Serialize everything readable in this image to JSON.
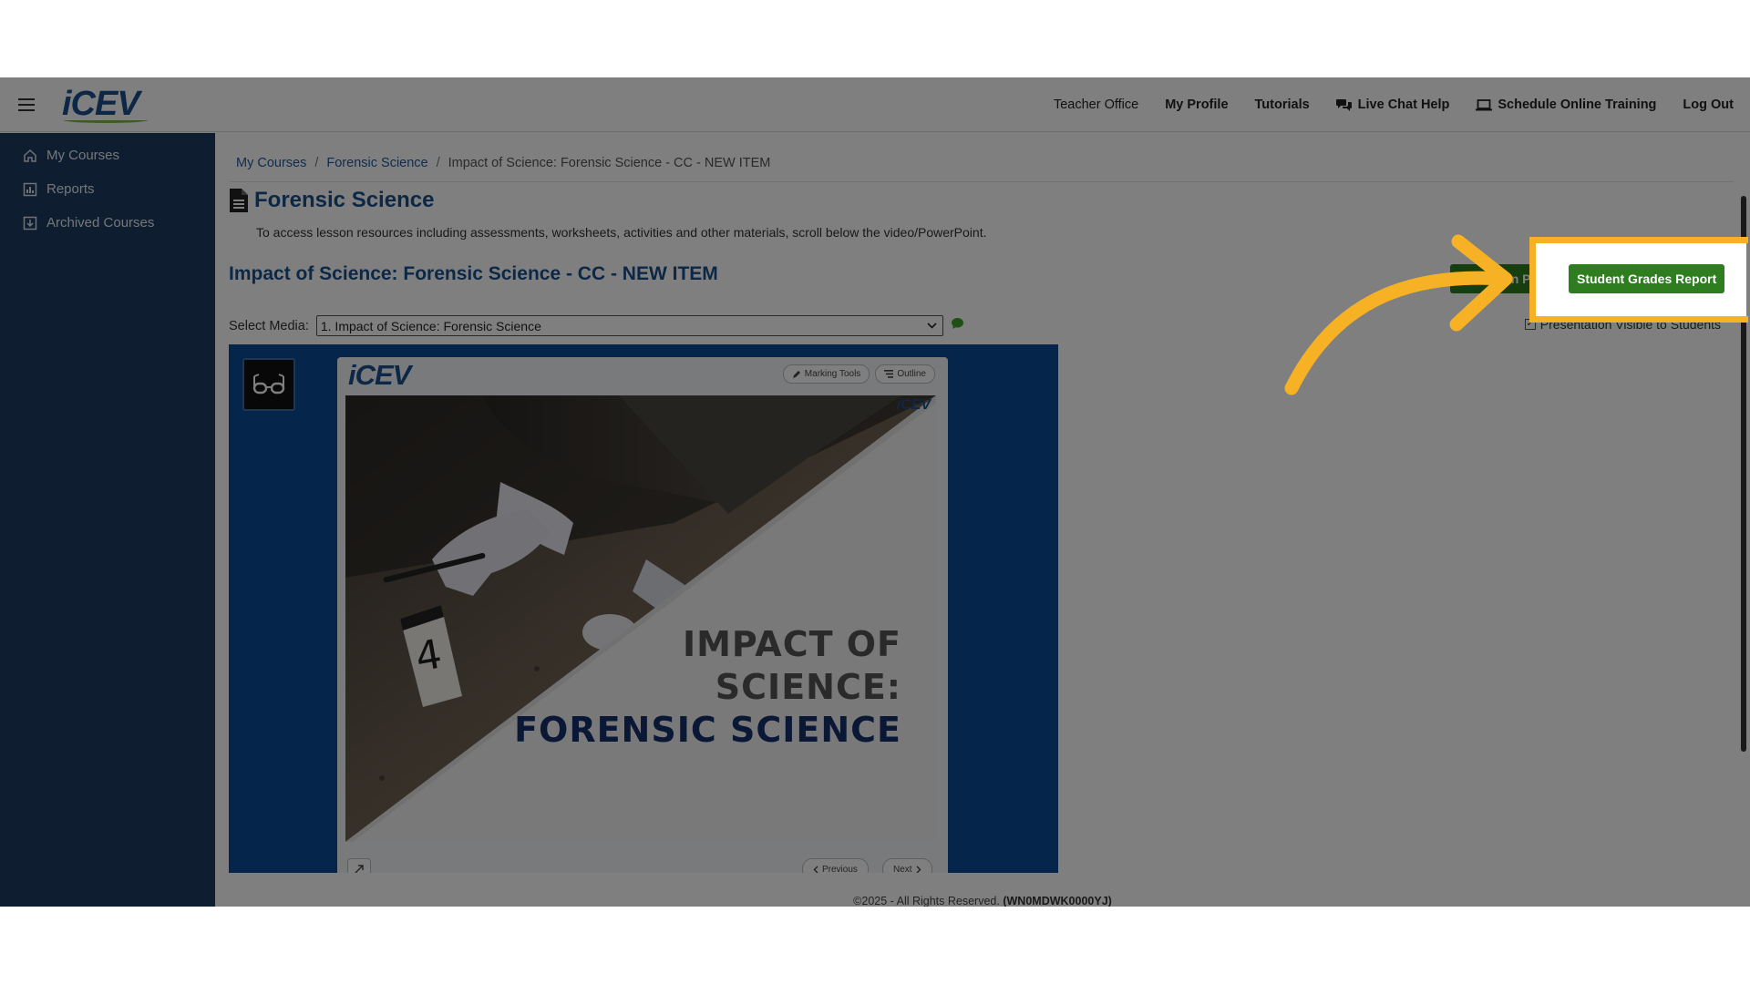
{
  "header": {
    "logo_text": "iCEV",
    "nav": [
      {
        "label": "Teacher Office",
        "icon": ""
      },
      {
        "label": "My Profile",
        "icon": ""
      },
      {
        "label": "Tutorials",
        "icon": ""
      },
      {
        "label": "Live Chat Help",
        "icon": "chat-bubbles-icon"
      },
      {
        "label": "Schedule Online Training",
        "icon": "laptop-icon"
      },
      {
        "label": "Log Out",
        "icon": ""
      }
    ]
  },
  "sidebar": {
    "items": [
      {
        "label": "My Courses",
        "icon": "home-icon"
      },
      {
        "label": "Reports",
        "icon": "report-icon"
      },
      {
        "label": "Archived Courses",
        "icon": "archive-icon"
      }
    ]
  },
  "breadcrumb": {
    "items": [
      "My Courses",
      "Forensic Science",
      "Impact of Science: Forensic Science - CC - NEW ITEM"
    ]
  },
  "page": {
    "title": "Forensic Science",
    "description": "To access lesson resources including assessments, worksheets, activities and other materials, scroll below the video/PowerPoint.",
    "item_title": "Impact of Science: Forensic Science - CC - NEW ITEM"
  },
  "buttons": {
    "lesson_plan": "Lesson Plan",
    "student_grades_report": "Student Grades Report"
  },
  "presentation_visible": {
    "label": "Presentation Visible to Students",
    "checked": true
  },
  "media": {
    "label": "Select Media:",
    "selected": "1. Impact of Science: Forensic Science"
  },
  "slide": {
    "logo_text": "iCEV",
    "marking_tools": "Marking Tools",
    "outline": "Outline",
    "evidence_marker": "4",
    "title_line1": "IMPACT OF",
    "title_line2": "SCIENCE:",
    "title_line3": "FORENSIC SCIENCE",
    "corner_logo": "iCEV",
    "previous": "Previous",
    "next": "Next"
  },
  "footer": {
    "copyright": "©2025 - All Rights Reserved.",
    "code": "(WN0MDWK0000YJ)"
  },
  "colors": {
    "brand_blue": "#1a4f8c",
    "sidebar_bg": "#1d3b5e",
    "button_green": "#2e7d1f",
    "highlight": "#f6b125",
    "viewer_blue": "#0a4d95"
  }
}
